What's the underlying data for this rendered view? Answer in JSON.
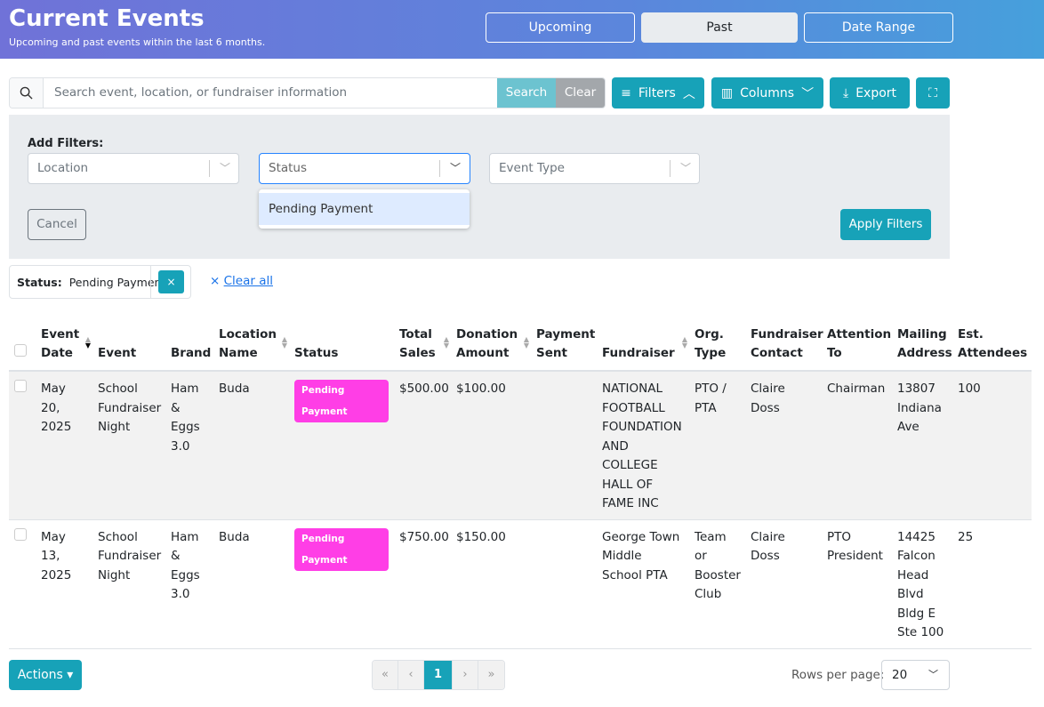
{
  "header": {
    "title": "Current Events",
    "subtitle": "Upcoming and past events within the last 6 months.",
    "tabs": [
      "Upcoming",
      "Past",
      "Date Range"
    ]
  },
  "search": {
    "placeholder": "Search event, location, or fundraiser information",
    "search_label": "Search",
    "clear_label": "Clear"
  },
  "toolbar": {
    "filters": "Filters",
    "columns": "Columns",
    "export": "Export"
  },
  "filters": {
    "title": "Add Filters:",
    "location": "Location",
    "status": "Status",
    "event_type": "Event Type",
    "option": "Pending Payment",
    "cancel": "Cancel",
    "apply": "Apply Filters"
  },
  "active_filter": {
    "label": "Status:",
    "value": "Pending Payment",
    "remove": "×",
    "clear_all": "Clear all",
    "clear_icon": "×"
  },
  "table": {
    "headers": [
      "Event Date",
      "Event",
      "Brand",
      "Location Name",
      "Status",
      "Total Sales",
      "Donation Amount",
      "Payment Sent",
      "Fundraiser",
      "Org. Type",
      "Fundraiser Contact",
      "Attention To",
      "Mailing Address",
      "Est. Attendees"
    ],
    "rows": [
      [
        "May 20, 2025",
        "School Fundraiser Night",
        "Ham & Eggs 3.0",
        "Buda",
        "Pending Payment",
        "$500.00",
        "$100.00",
        "",
        "NATIONAL FOOTBALL FOUNDATION AND COLLEGE HALL OF FAME INC",
        "PTO / PTA",
        "Claire Doss",
        "Chairman",
        "13807 Indiana Ave",
        "100"
      ],
      [
        "May 13, 2025",
        "School Fundraiser Night",
        "Ham & Eggs 3.0",
        "Buda",
        "Pending Payment",
        "$750.00",
        "$150.00",
        "",
        "George Town Middle School PTA",
        "Team or Booster Club",
        "Claire Doss",
        "PTO President",
        "14425 Falcon Head Blvd Bldg E Ste 100",
        "25"
      ]
    ]
  },
  "footer": {
    "actions": "Actions ▾",
    "pages": [
      "«",
      "‹",
      "1",
      "›",
      "»"
    ],
    "rows_per_page_label": "Rows per page:",
    "rows_per_page": "20"
  },
  "colors": {
    "accent": "#17a2b8",
    "badge": "#ff3ee6"
  }
}
